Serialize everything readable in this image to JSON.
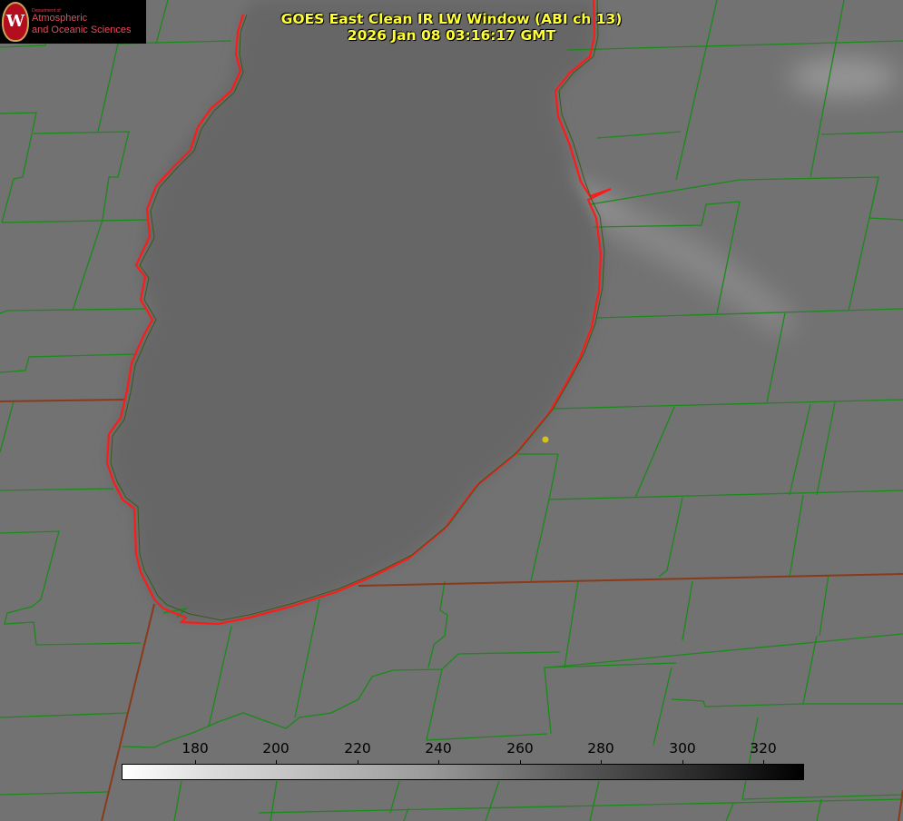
{
  "logo": {
    "dept": "Department of",
    "line1": "Atmospheric",
    "line2": "and Oceanic Sciences",
    "seal_letter": "W"
  },
  "title": {
    "line1": "GOES East Clean IR LW Window (ABI ch 13)",
    "line2": "2026 Jan 08 03:16:17 GMT"
  },
  "colorbar": {
    "ticks": [
      "180",
      "200",
      "220",
      "240",
      "260",
      "280",
      "300",
      "320"
    ],
    "gradient": "white-to-black"
  },
  "colors": {
    "background": "#727272",
    "lake": "#666666",
    "county_lines": "#1a8a1a",
    "coastline": "#ff1a1a",
    "title": "#ffff33",
    "marker": "#d8c21a"
  }
}
